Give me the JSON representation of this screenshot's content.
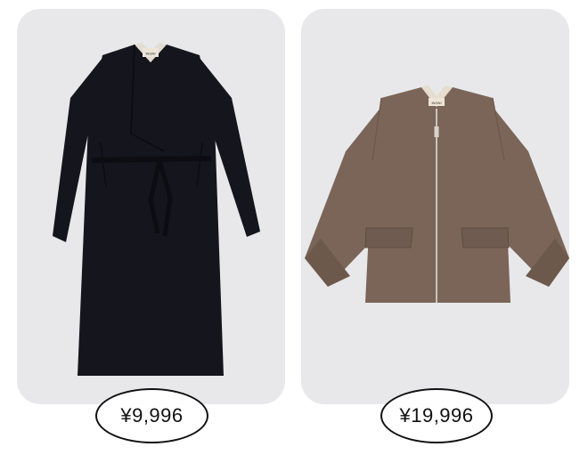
{
  "products": [
    {
      "name": "black-long-wrap-coat",
      "image": "black long belted wool coat",
      "brand_tag": "INGNI",
      "price": "¥9,996",
      "color": "#15151d"
    },
    {
      "name": "brown-zip-jacket",
      "image": "brown short zip-up wool jacket",
      "brand_tag": "INGNI",
      "price": "¥19,996",
      "color": "#7a6558"
    }
  ]
}
